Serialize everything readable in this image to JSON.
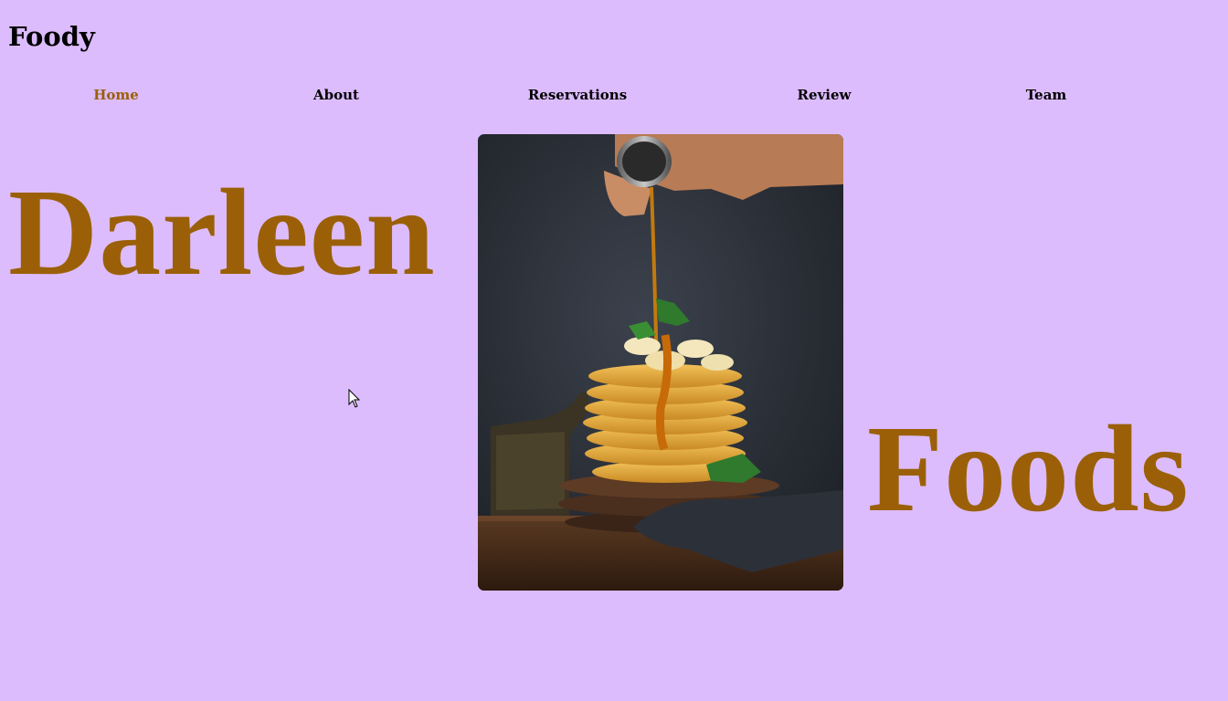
{
  "brand": {
    "logo_text": "Foody"
  },
  "nav": {
    "items": [
      {
        "label": "Home",
        "active": true
      },
      {
        "label": "About",
        "active": false
      },
      {
        "label": "Reservations",
        "active": false
      },
      {
        "label": "Review",
        "active": false
      },
      {
        "label": "Team",
        "active": false
      }
    ]
  },
  "hero": {
    "word_left": "Darleen",
    "word_right": "Foods",
    "image_alt": "pancake-stack-with-syrup-photo"
  },
  "colors": {
    "background": "#dcbcfd",
    "accent": "#9b6007",
    "text": "#000000"
  }
}
